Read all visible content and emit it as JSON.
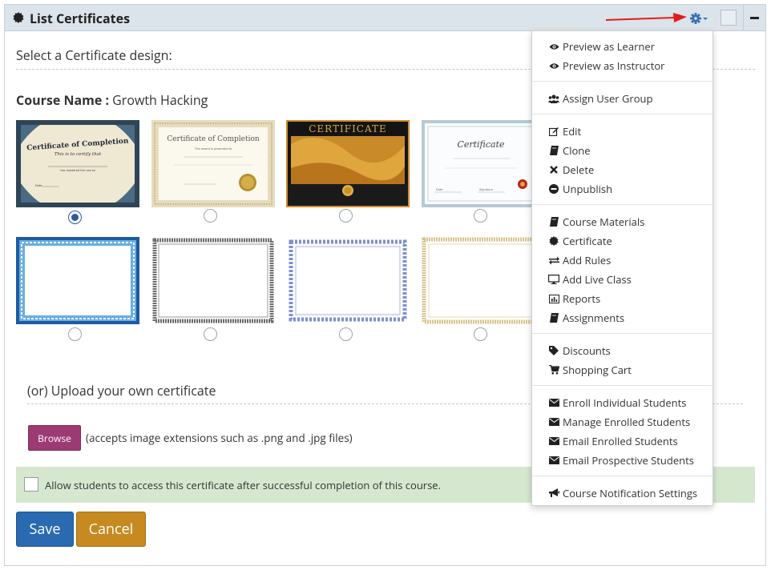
{
  "header": {
    "title": "List Certificates"
  },
  "main": {
    "select_title": "Select a Certificate design:",
    "course_label": "Course Name :",
    "course_name": "Growth Hacking",
    "upload_title": "(or) Upload your own certificate",
    "browse_label": "Browse",
    "accepts_text": "(accepts image extensions such as .png and .jpg files)",
    "allow_label": "Allow students to access this certificate after successful completion of this course.",
    "allow_checked": false,
    "save_label": "Save",
    "cancel_label": "Cancel",
    "selected_design_index": 0
  },
  "certificates": [
    {
      "title": "Certificate of Completion",
      "subtitle": "This is to certify that",
      "line": "has mastered the course",
      "date_label": "Date"
    },
    {
      "title": "Certificate of Completion",
      "subtitle": "This award is presented to"
    },
    {
      "title": "CERTIFICATE"
    },
    {
      "title": "Certificate",
      "left_label": "Date",
      "right_label": "Signature"
    }
  ],
  "dropdown": {
    "items": [
      {
        "label": "Preview as Learner",
        "icon": "eye-icon"
      },
      {
        "label": "Preview as Instructor",
        "icon": "eye-icon"
      },
      {
        "label": "Assign User Group",
        "icon": "users-icon"
      },
      {
        "label": "Edit",
        "icon": "edit-icon"
      },
      {
        "label": "Clone",
        "icon": "book-icon"
      },
      {
        "label": "Delete",
        "icon": "times-icon"
      },
      {
        "label": "Unpublish",
        "icon": "minus-circle-icon"
      },
      {
        "label": "Course Materials",
        "icon": "book-icon"
      },
      {
        "label": "Certificate",
        "icon": "certificate-icon"
      },
      {
        "label": "Add Rules",
        "icon": "exchange-icon"
      },
      {
        "label": "Add Live Class",
        "icon": "desktop-icon"
      },
      {
        "label": "Reports",
        "icon": "bar-chart-icon"
      },
      {
        "label": "Assignments",
        "icon": "book-icon"
      },
      {
        "label": "Discounts",
        "icon": "tag-icon"
      },
      {
        "label": "Shopping Cart",
        "icon": "cart-icon"
      },
      {
        "label": "Enroll Individual Students",
        "icon": "envelope-icon"
      },
      {
        "label": "Manage Enrolled Students",
        "icon": "envelope-icon"
      },
      {
        "label": "Email Enrolled Students",
        "icon": "envelope-icon"
      },
      {
        "label": "Email Prospective Students",
        "icon": "envelope-icon"
      },
      {
        "label": "Course Notification Settings",
        "icon": "bullhorn-icon"
      }
    ]
  },
  "colors": {
    "header_bg": "#dbe4ea",
    "browse": "#9c3a73",
    "save": "#2a6ab0",
    "cancel": "#c68a21",
    "notice_bg": "#d5e8cf",
    "gear": "#3b6fb6"
  }
}
